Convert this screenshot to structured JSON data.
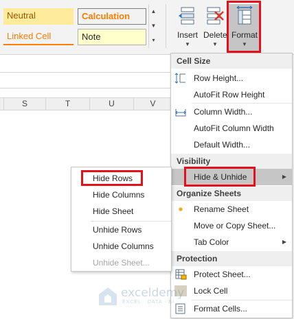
{
  "ribbon": {
    "styles": {
      "neutral": "Neutral",
      "calculation": "Calculation",
      "linked_cell": "Linked Cell",
      "note": "Note"
    },
    "insert_label": "Insert",
    "delete_label": "Delete",
    "format_label": "Format"
  },
  "columns": [
    "S",
    "T",
    "U",
    "V"
  ],
  "format_menu": {
    "cell_size": {
      "header": "Cell Size",
      "row_height": "Row Height...",
      "autofit_row_height": "AutoFit Row Height",
      "column_width": "Column Width...",
      "autofit_column_width": "AutoFit Column Width",
      "default_width": "Default Width..."
    },
    "visibility": {
      "header": "Visibility",
      "hide_unhide": "Hide & Unhide"
    },
    "organize_sheets": {
      "header": "Organize Sheets",
      "rename_sheet": "Rename Sheet",
      "move_copy_sheet": "Move or Copy Sheet...",
      "tab_color": "Tab Color"
    },
    "protection": {
      "header": "Protection",
      "protect_sheet": "Protect Sheet...",
      "lock_cell": "Lock Cell",
      "format_cells": "Format Cells..."
    }
  },
  "hide_unhide_submenu": {
    "hide_rows": "Hide Rows",
    "hide_columns": "Hide Columns",
    "hide_sheet": "Hide Sheet",
    "unhide_rows": "Unhide Rows",
    "unhide_columns": "Unhide Columns",
    "unhide_sheet": "Unhide Sheet..."
  },
  "watermark": {
    "name": "exceldemy",
    "tagline": "EXCEL · DATA · BI"
  },
  "colors": {
    "highlight": "#e3111c",
    "hover": "#c6c6c6",
    "rename_bullet": "#f4a522",
    "delete_x": "#d9372b"
  },
  "icons": [
    "row-height-icon",
    "column-width-icon",
    "protect-sheet-icon",
    "lock-cell-icon",
    "format-cells-icon",
    "insert-cells-icon",
    "delete-cells-icon",
    "format-icon"
  ]
}
